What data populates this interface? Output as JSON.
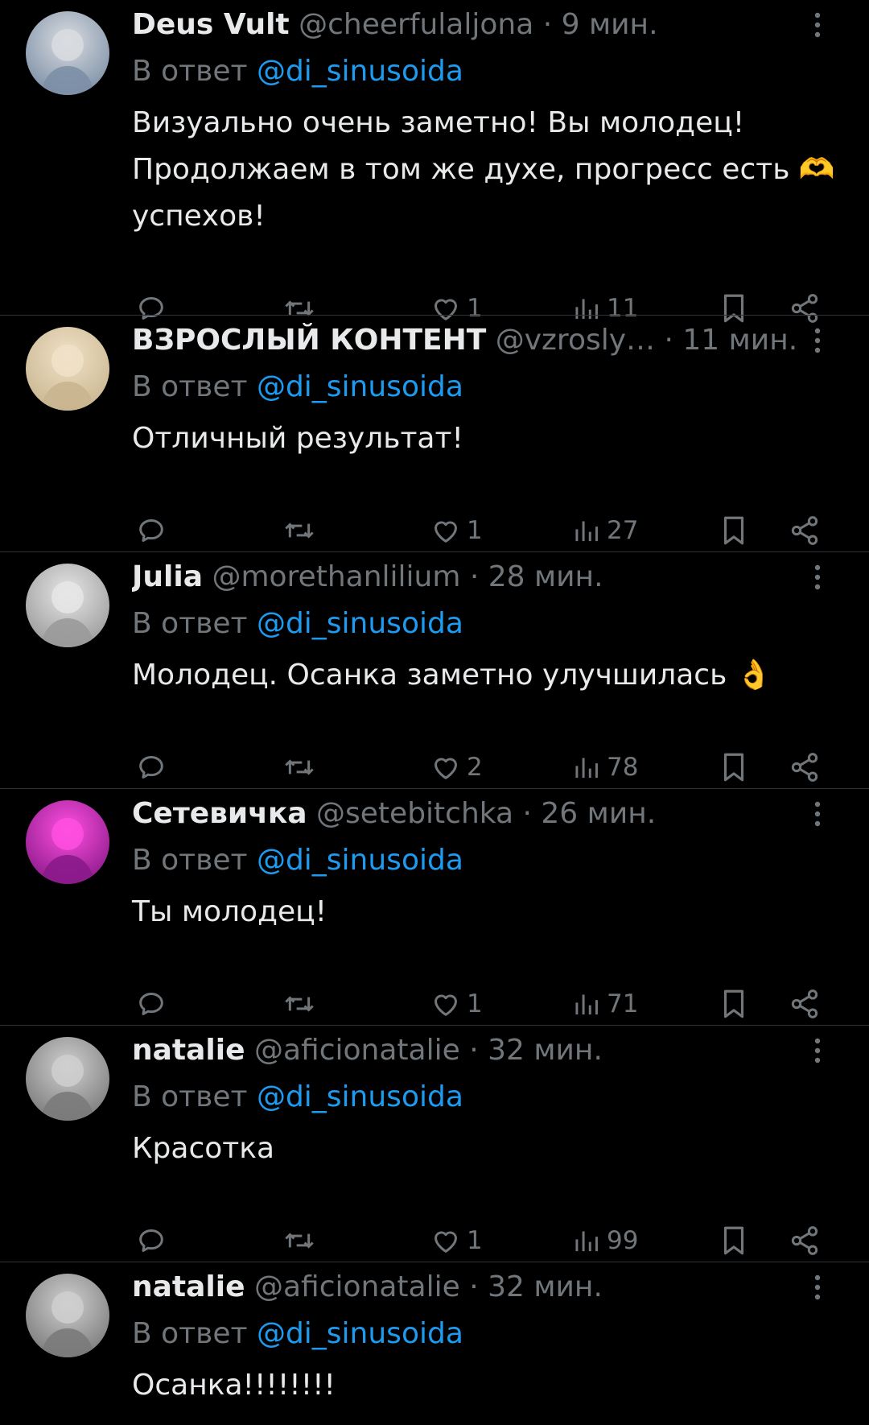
{
  "replying_prefix": "В ответ",
  "replies": [
    {
      "name": "Deus Vult",
      "handle": "@cheerfulaljona",
      "time": "9 мин.",
      "mention": "@di_sinusoida",
      "text": "Визуально очень заметно! Вы молодец!\nПродолжаем в том же духе, прогресс есть 🫶\nуспехов!",
      "likes": "1",
      "views": "11",
      "avatar_colors": [
        "#7c8fa6",
        "#d9dce0"
      ]
    },
    {
      "name": "ВЗРОСЛЫЙ КОНТЕНТ",
      "handle": "@vzrosly…",
      "time": "11 мин.",
      "mention": "@di_sinusoida",
      "text": "Отличный результат!",
      "likes": "1",
      "views": "27",
      "avatar_colors": [
        "#c9b58f",
        "#f0e2c8"
      ]
    },
    {
      "name": "Julia",
      "handle": "@morethanlilium",
      "time": "28 мин.",
      "mention": "@di_sinusoida",
      "text": "Молодец. Осанка заметно улучшилась 👌",
      "likes": "2",
      "views": "78",
      "avatar_colors": [
        "#9a9a9a",
        "#e6e6e6"
      ]
    },
    {
      "name": "Сетевичка",
      "handle": "@setebitchka",
      "time": "26 мин.",
      "mention": "@di_sinusoida",
      "text": "Ты молодец!",
      "likes": "1",
      "views": "71",
      "avatar_colors": [
        "#8a1a8a",
        "#ff4fe0"
      ]
    },
    {
      "name": "natalie",
      "handle": "@aficionatalie",
      "time": "32 мин.",
      "mention": "@di_sinusoida",
      "text": "Красотка",
      "likes": "1",
      "views": "99",
      "avatar_colors": [
        "#7a7a7a",
        "#cfcfcf"
      ]
    },
    {
      "name": "natalie",
      "handle": "@aficionatalie",
      "time": "32 мин.",
      "mention": "@di_sinusoida",
      "text": "Осанка!!!!!!!!",
      "likes": "",
      "views": "",
      "avatar_colors": [
        "#7a7a7a",
        "#cfcfcf"
      ]
    }
  ],
  "icons": {
    "reply": "reply-icon",
    "repost": "repost-icon",
    "like": "like-icon",
    "views": "views-icon",
    "bookmark": "bookmark-icon",
    "share": "share-icon",
    "more": "more-options-icon"
  },
  "colors": {
    "background": "#000000",
    "text": "#e7e9ea",
    "secondary": "#71767b",
    "link": "#1d9bf0",
    "divider": "#2f3336"
  }
}
